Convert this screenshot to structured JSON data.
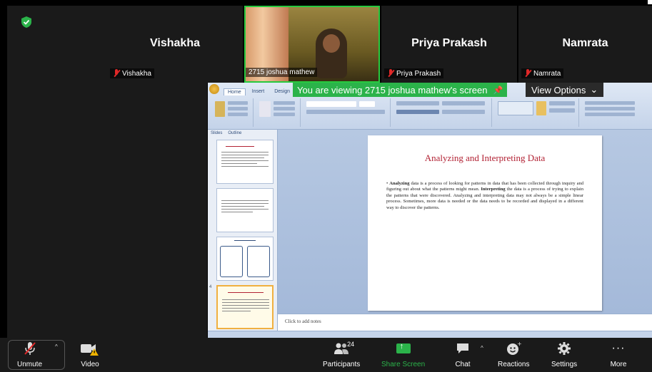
{
  "security": {
    "icon": "shield-check-icon",
    "color": "#2bb34a"
  },
  "participants_tiles": [
    {
      "name": "Vishakha",
      "label": "Vishakha",
      "muted": true
    },
    {
      "name": "",
      "label": "2715 joshua mathew",
      "video": true
    },
    {
      "name": "Priya Prakash",
      "label": "Priya Prakash",
      "muted": true
    },
    {
      "name": "Namrata",
      "label": "Namrata",
      "muted": true
    }
  ],
  "share_banner": {
    "text": "You are viewing 2715 joshua mathew's screen",
    "view_options": "View Options"
  },
  "presentation": {
    "ribbon_tabs": [
      "Home",
      "Insert",
      "Design"
    ],
    "panel_tabs": [
      "Slides",
      "Outline"
    ],
    "slide_title": "Analyzing and Interpreting Data",
    "slide_body_bold1": "Analyzing",
    "slide_body_part1": " data is a process of looking for patterns in data that has been collected through inquiry and figuring out about what the patterns might mean. ",
    "slide_body_bold2": "Interpreting",
    "slide_body_part2": " the data is a process of trying to explain the patterns that were discovered. Analyzing and interpreting data may not always be a simple linear process. Sometimes, more data is needed or the data needs to be recorded and displayed in a different way to discover the patterns.",
    "notes_placeholder": "Click to add notes",
    "thumb_numbers": [
      "",
      "",
      "",
      "4"
    ]
  },
  "toolbar": {
    "unmute": "Unmute",
    "video": "Video",
    "participants": "Participants",
    "participants_count": "24",
    "share_screen": "Share Screen",
    "chat": "Chat",
    "reactions": "Reactions",
    "settings": "Settings",
    "more": "More"
  },
  "colors": {
    "accent_green": "#2bb34a",
    "mute_red": "#e02828",
    "slide_title_red": "#b22234"
  }
}
